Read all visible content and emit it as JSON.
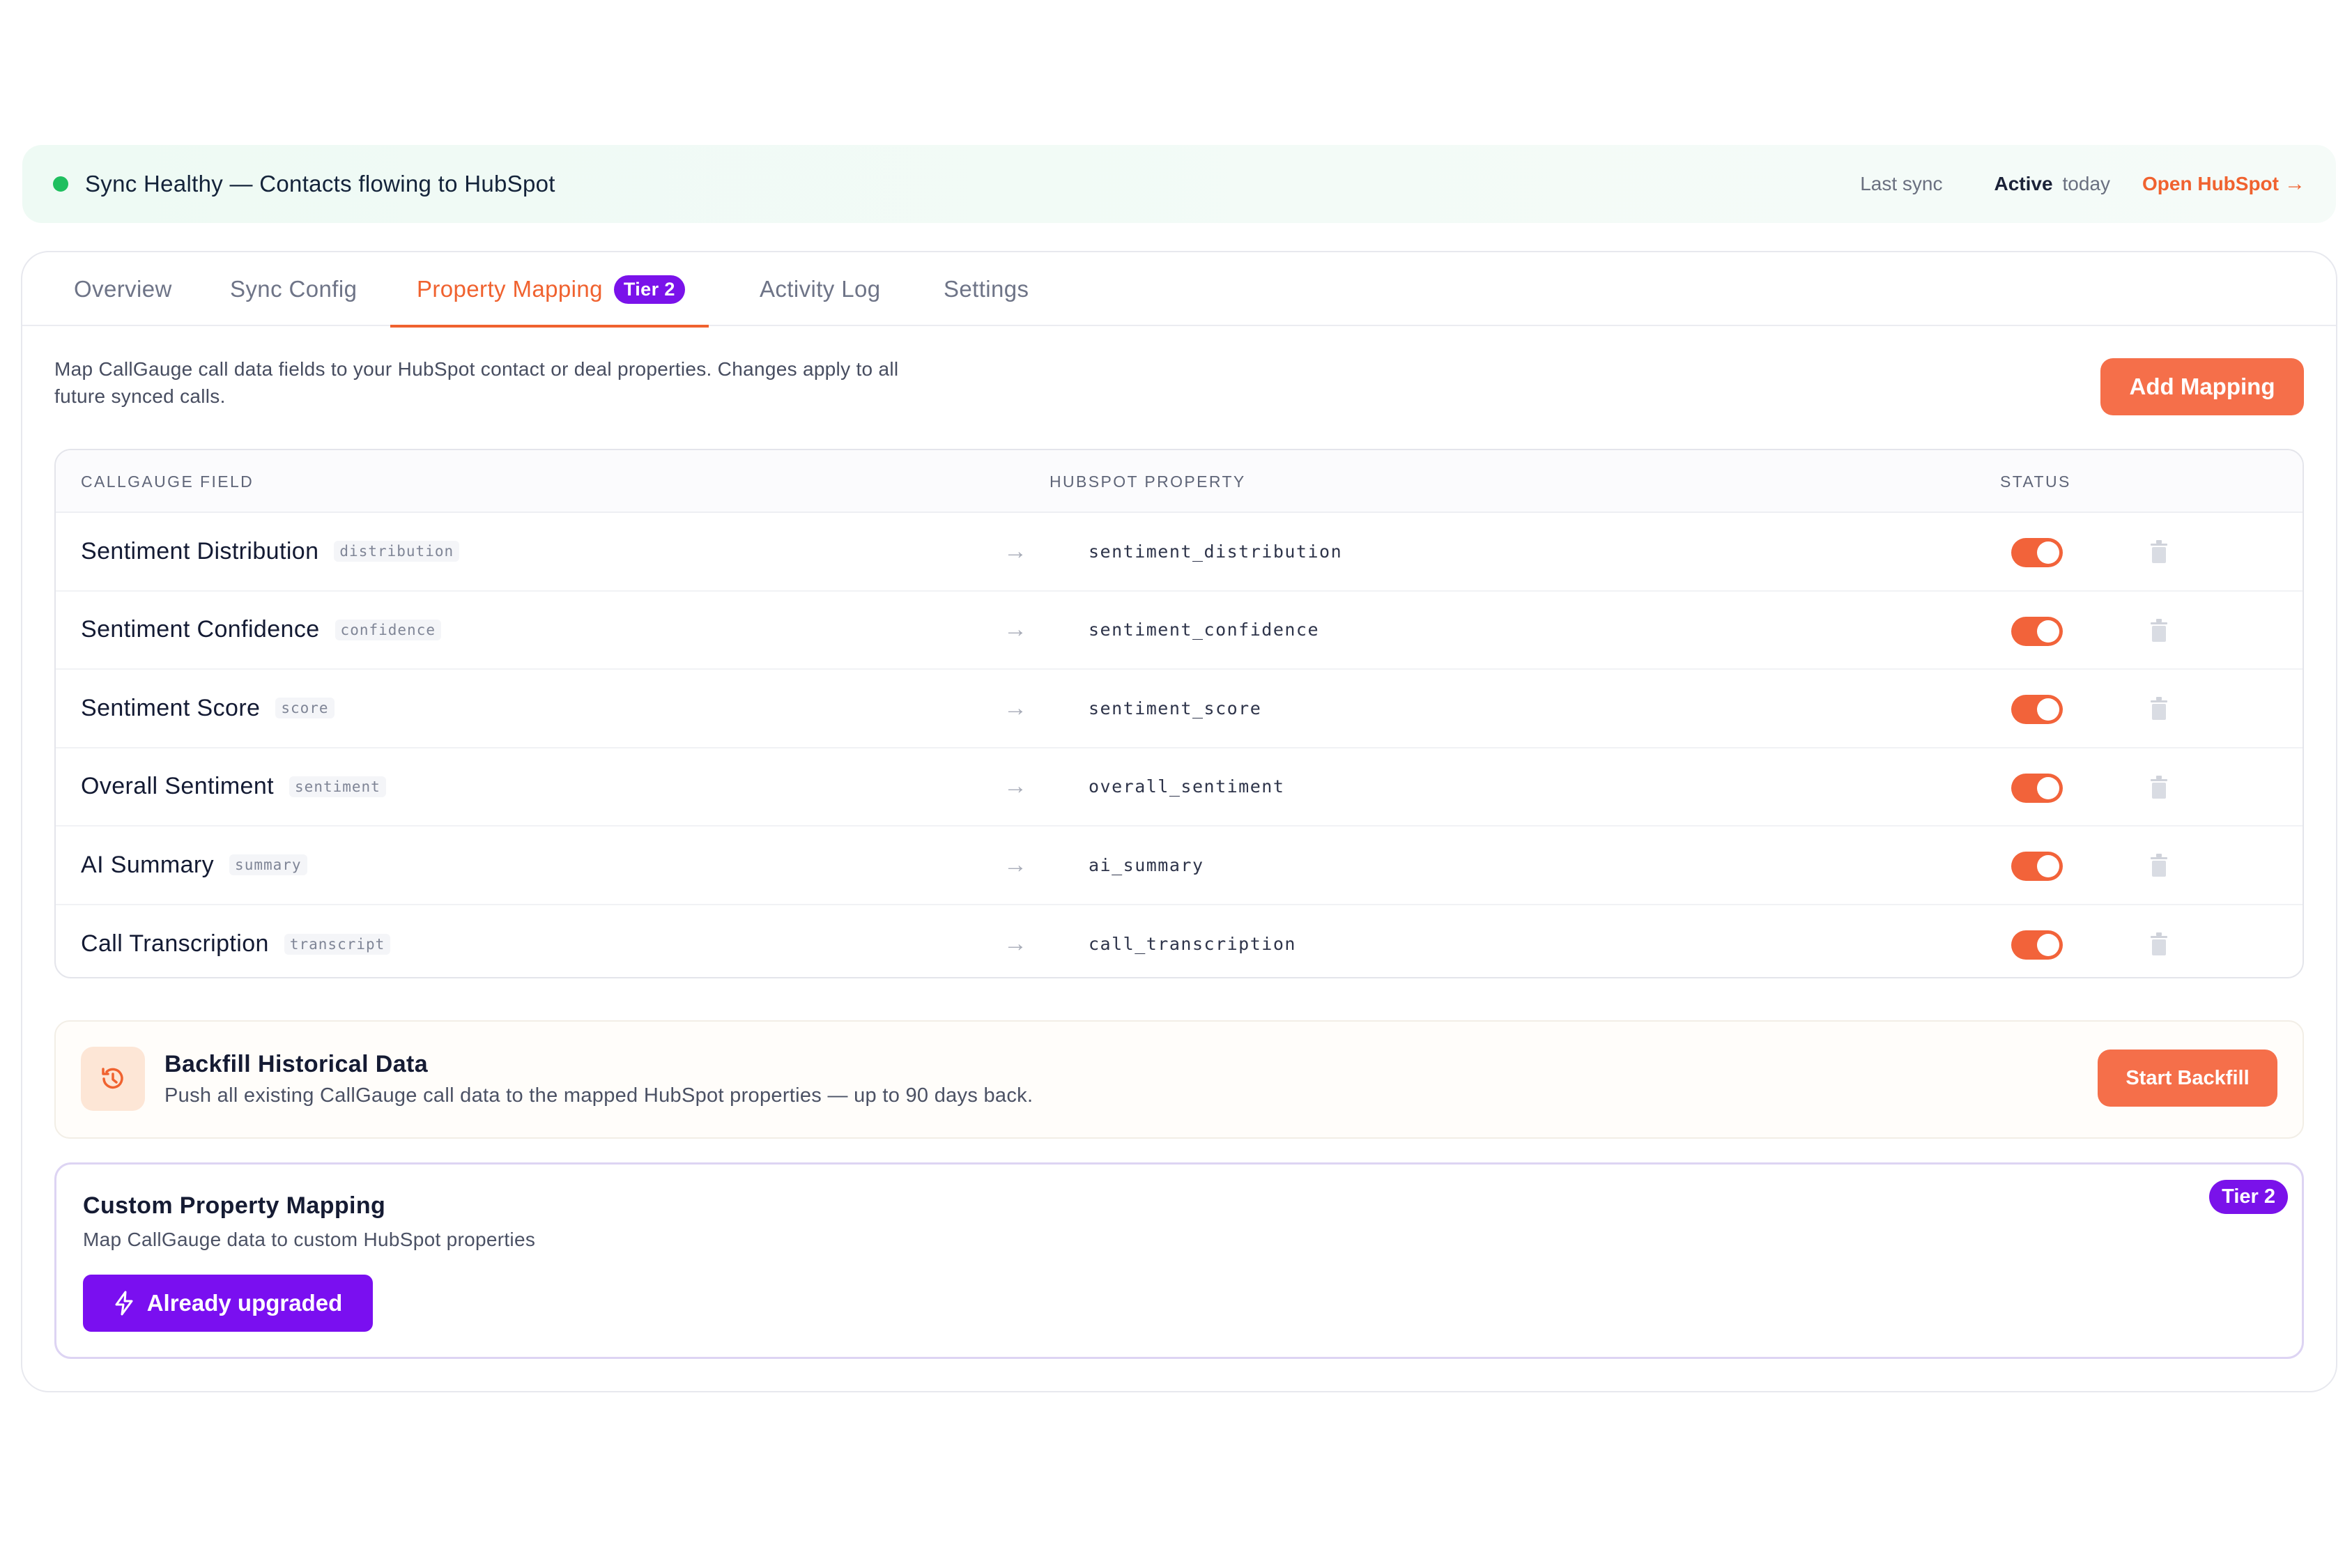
{
  "banner": {
    "status_text": "Sync Healthy — Contacts flowing to HubSpot",
    "last_sync_label": "Last sync",
    "active_label": "Active",
    "active_when": "today",
    "open_link": "Open HubSpot",
    "open_arrow": "→",
    "status_color": "#1fbf5f"
  },
  "tabs": [
    {
      "label": "Overview"
    },
    {
      "label": "Sync Config"
    },
    {
      "label": "Property Mapping",
      "badge": "Tier 2",
      "active": true
    },
    {
      "label": "Activity Log"
    },
    {
      "label": "Settings"
    }
  ],
  "intro": {
    "description": "Map CallGauge call data fields to your HubSpot contact or deal properties. Changes apply to all future synced calls.",
    "add_button": "Add Mapping"
  },
  "table": {
    "headers": {
      "field": "CALLGAUGE FIELD",
      "property": "HUBSPOT PROPERTY",
      "status": "STATUS"
    },
    "rows": [
      {
        "name": "Sentiment Distribution",
        "key": "distribution",
        "property": "sentiment_distribution",
        "enabled": true
      },
      {
        "name": "Sentiment Confidence",
        "key": "confidence",
        "property": "sentiment_confidence",
        "enabled": true
      },
      {
        "name": "Sentiment Score",
        "key": "score",
        "property": "sentiment_score",
        "enabled": true
      },
      {
        "name": "Overall Sentiment",
        "key": "sentiment",
        "property": "overall_sentiment",
        "enabled": true
      },
      {
        "name": "AI Summary",
        "key": "summary",
        "property": "ai_summary",
        "enabled": true
      },
      {
        "name": "Call Transcription",
        "key": "transcript",
        "property": "call_transcription",
        "enabled": true
      }
    ]
  },
  "backfill": {
    "title": "Backfill Historical Data",
    "description": "Push all existing CallGauge call data to the mapped HubSpot properties — up to 90 days back.",
    "button": "Start Backfill",
    "icon": "history-icon"
  },
  "custom": {
    "title": "Custom Property Mapping",
    "description": "Map CallGauge data to custom HubSpot properties",
    "tier_badge": "Tier 2",
    "button": "Already upgraded",
    "icon": "lightning-icon"
  },
  "colors": {
    "accent": "#f0622f",
    "button": "#f56f4a",
    "tier": "#7a12ea"
  }
}
